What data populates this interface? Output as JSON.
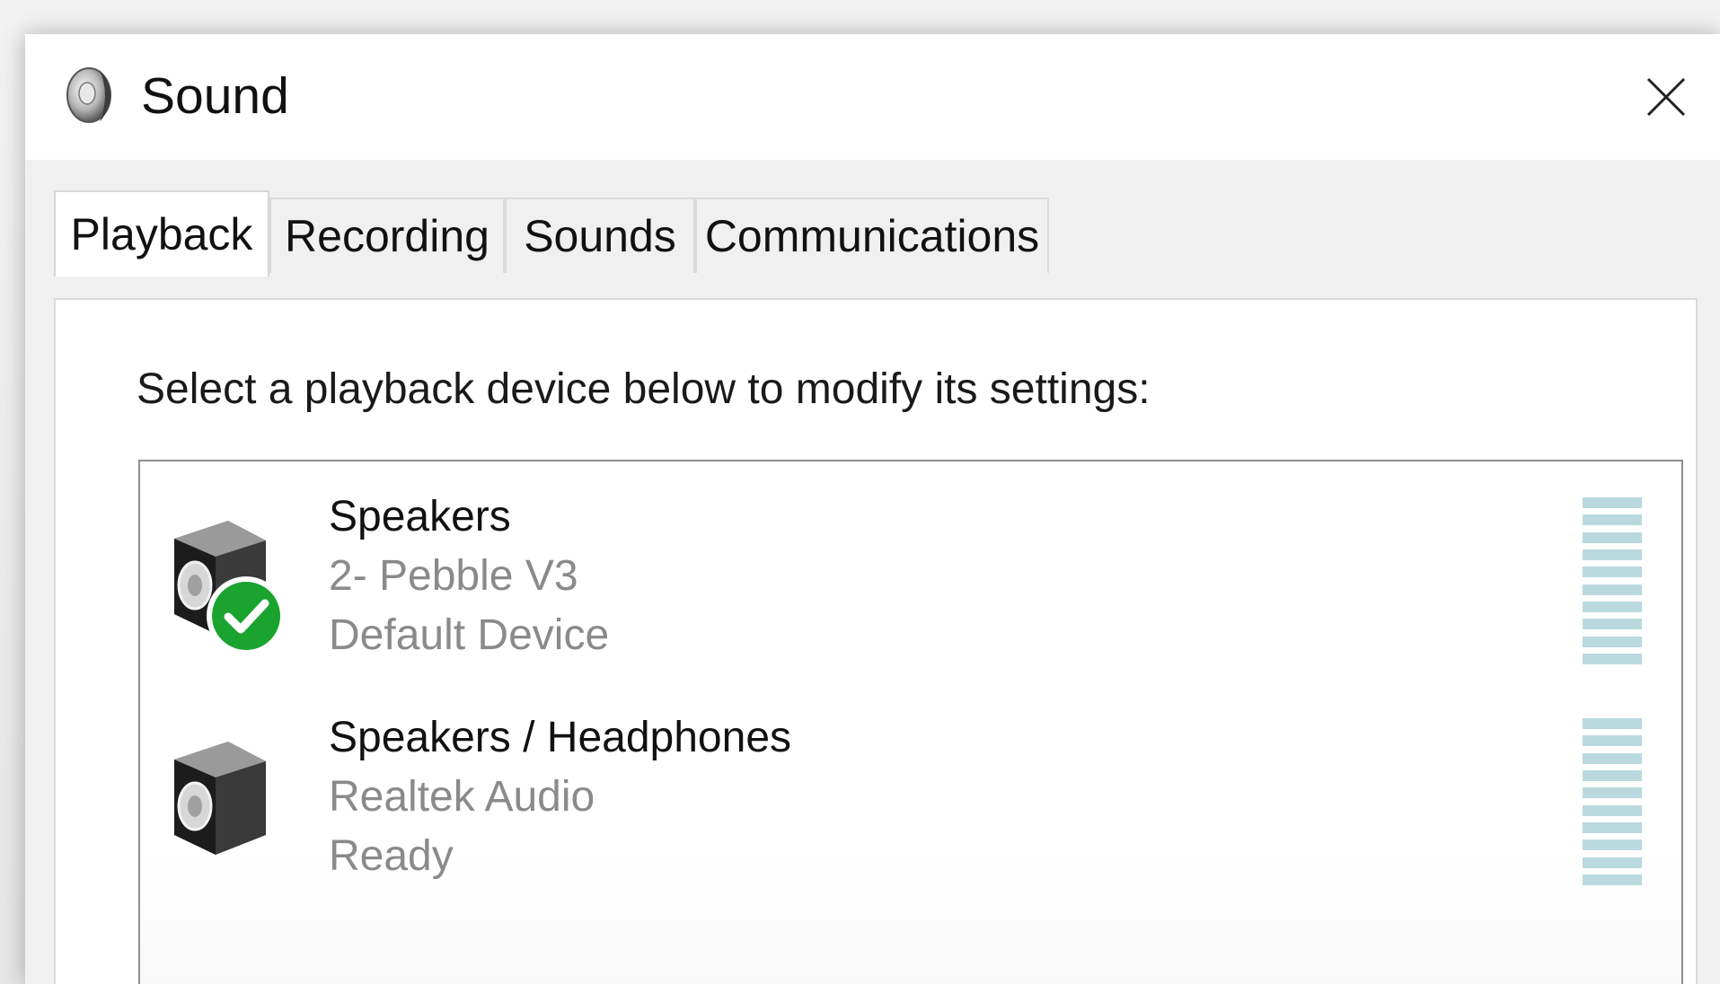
{
  "window": {
    "title": "Sound",
    "app_icon": "speaker-icon",
    "close_icon": "close-icon"
  },
  "tabs": [
    {
      "label": "Playback",
      "active": true
    },
    {
      "label": "Recording",
      "active": false
    },
    {
      "label": "Sounds",
      "active": false
    },
    {
      "label": "Communications",
      "active": false
    }
  ],
  "playback": {
    "instruction": "Select a playback device below to modify its settings:",
    "devices": [
      {
        "name": "Speakers",
        "description": "2- Pebble V3",
        "status": "Default Device",
        "icon": "speaker-icon",
        "badge_icon": "check-circle-icon",
        "badge_color": "#1aa32f"
      },
      {
        "name": "Speakers / Headphones",
        "description": "Realtek Audio",
        "status": "Ready",
        "icon": "speaker-icon"
      }
    ]
  },
  "colors": {
    "level_meter": "#b9d9df",
    "secondary_text": "#8a8a8a"
  }
}
